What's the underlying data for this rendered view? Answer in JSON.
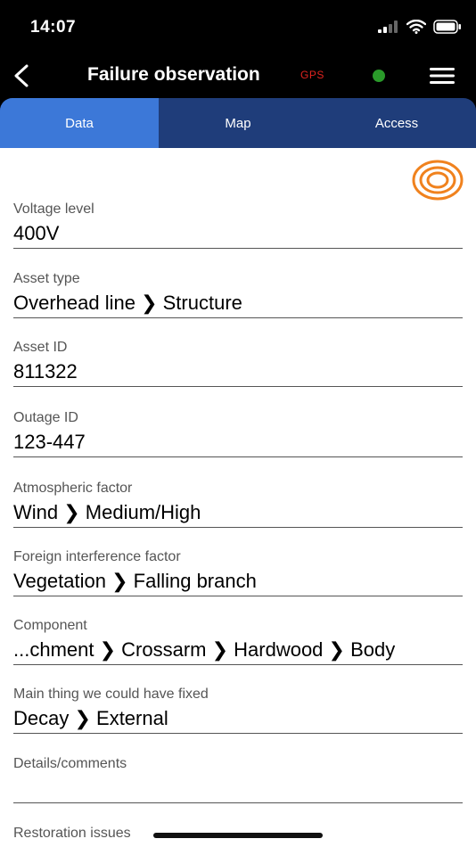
{
  "status": {
    "time": "14:07"
  },
  "header": {
    "title": "Failure observation",
    "gps_label": "GPS",
    "gps_status_color": "#2a9a2a"
  },
  "tabs": [
    {
      "label": "Data",
      "active": true
    },
    {
      "label": "Map",
      "active": false
    },
    {
      "label": "Access",
      "active": false
    }
  ],
  "fields": {
    "voltage_level": {
      "label": "Voltage level",
      "value": "400V"
    },
    "asset_type": {
      "label": "Asset type",
      "value": "Overhead line ❯ Structure"
    },
    "asset_id": {
      "label": "Asset ID",
      "value": "811322"
    },
    "outage_id": {
      "label": "Outage ID",
      "value": "123-447"
    },
    "atmospheric_factor": {
      "label": "Atmospheric factor",
      "value": "Wind ❯ Medium/High"
    },
    "foreign_interference": {
      "label": "Foreign interference factor",
      "value": "Vegetation ❯ Falling branch"
    },
    "component": {
      "label": "Component",
      "value": "...chment ❯ Crossarm ❯ Hardwood ❯ Body"
    },
    "main_thing": {
      "label": "Main thing we could have fixed",
      "value": "Decay ❯ External"
    },
    "details": {
      "label": "Details/comments",
      "value": ""
    },
    "restoration": {
      "label": "Restoration issues"
    }
  },
  "colors": {
    "accent": "#3c78d8",
    "tab_bar": "#1f3d7a",
    "target_icon": "#f0821e"
  }
}
